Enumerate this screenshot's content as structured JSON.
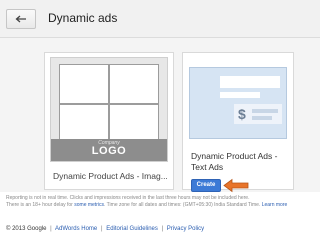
{
  "header": {
    "back_icon": "back-arrow-icon",
    "title": "Dynamic ads"
  },
  "cards": {
    "image_ads": {
      "thumbnail_company": "Company",
      "thumbnail_logo": "LOGO",
      "title": "Dynamic Product Ads - Imag..."
    },
    "text_ads": {
      "thumbnail_symbol": "$",
      "title": "Dynamic Product Ads - Text Ads",
      "create_label": "Create",
      "accent_color": "#3c7ad6",
      "annotation_arrow_color": "#e8742a"
    }
  },
  "notice": {
    "line1": "Reporting is not in real time. Clicks and impressions received in the last three hours may not be included here.",
    "line2_prefix": "There is an 18+ hour delay for ",
    "line2_link": "some metrics",
    "line2_suffix": ". Time zone for all dates and times: (GMT+05:30) India Standard Time. ",
    "learn_more": "Learn more"
  },
  "footer": {
    "copyright": "© 2013 Google",
    "links": [
      "AdWords Home",
      "Editorial Guidelines",
      "Privacy Policy"
    ]
  }
}
